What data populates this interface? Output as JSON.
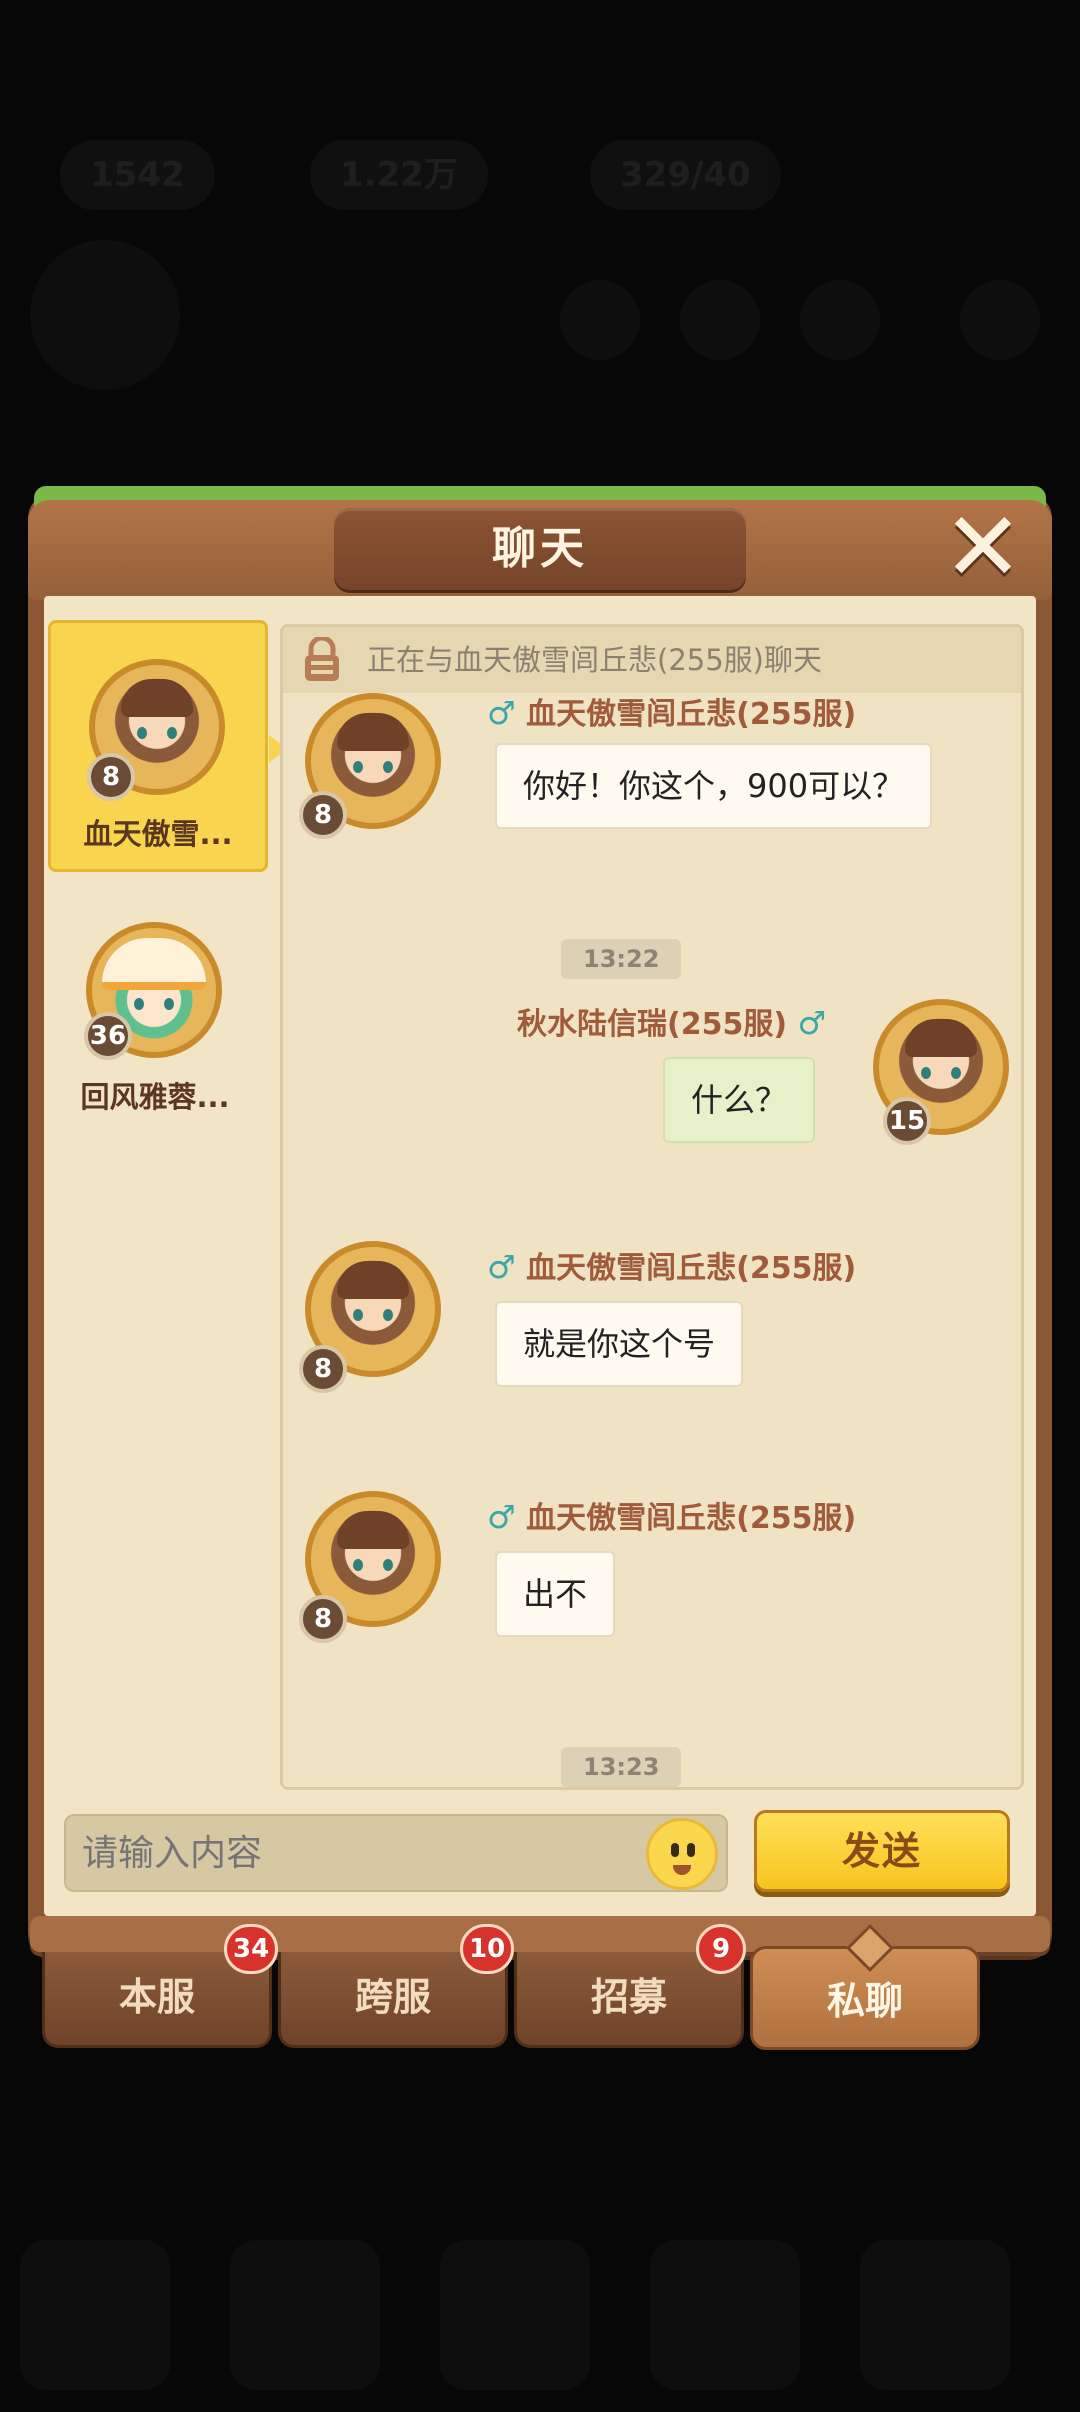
{
  "window": {
    "title": "聊天"
  },
  "background_hud": {
    "stat1": "1542",
    "stat2": "1.22万",
    "stat3": "329/40"
  },
  "contacts": [
    {
      "name": "血天傲雪...",
      "level": "8",
      "active": true
    },
    {
      "name": "回风雅蓉...",
      "level": "36",
      "active": false
    }
  ],
  "chat": {
    "header": "正在与血天傲雪闾丘悲(255服)聊天",
    "messages": [
      {
        "sender": "血天傲雪闾丘悲(255服)",
        "text": "你好！你这个，900可以？",
        "level": "8",
        "mine": false
      },
      {
        "time": "13:22"
      },
      {
        "sender": "秋水陆信瑞(255服)",
        "text": "什么？",
        "level": "15",
        "mine": true
      },
      {
        "sender": "血天傲雪闾丘悲(255服)",
        "text": "就是你这个号",
        "level": "8",
        "mine": false
      },
      {
        "sender": "血天傲雪闾丘悲(255服)",
        "text": "出不",
        "level": "8",
        "mine": false
      },
      {
        "time": "13:23"
      }
    ]
  },
  "input": {
    "placeholder": "请输入内容"
  },
  "send_label": "发送",
  "tabs": [
    {
      "label": "本服",
      "badge": "34"
    },
    {
      "label": "跨服",
      "badge": "10"
    },
    {
      "label": "招募",
      "badge": "9"
    },
    {
      "label": "私聊",
      "badge": "",
      "active": true
    }
  ],
  "colors": {
    "panel": "#8a5634",
    "content": "#f2e5c6",
    "accent": "#f9d54f",
    "badge": "#d8322c"
  }
}
